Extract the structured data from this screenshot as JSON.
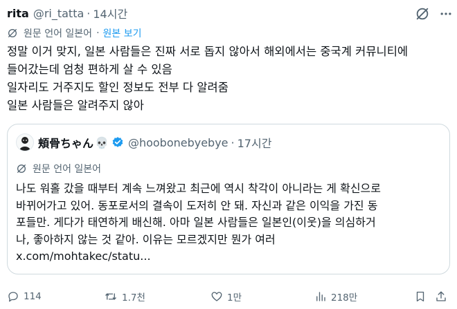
{
  "post": {
    "author_name": "rita",
    "author_handle": "@ri_tatta",
    "separator": "·",
    "time": "14시간",
    "translate_label": "원문 언어 일본어",
    "show_original_label": "원본 보기",
    "body_lines": [
      "정말 이거 맞지, 일본 사람들은 진짜 서로 돕지 않아서 해외에서는 중국계 커뮤니티에",
      "들어갔는데 엄청 편하게 살 수 있음",
      "일자리도 거주지도 할인 정보도 전부 다 알려줌",
      "일본 사람들은 알려주지 않아"
    ]
  },
  "quote": {
    "author_name": "頬骨ちゃん",
    "author_emoji": "💀",
    "author_handle": "@hoobonebyebye",
    "separator": "·",
    "time": "17시간",
    "translate_label": "원문 언어 일본어",
    "text_lines": [
      "나도 워홀 갔을 때부터 계속 느껴왔고 최근에 역시 착각이 아니라는 게 확신으로",
      "바뀌어가고 있어. 동포로서의 결속이 도저히 안 돼. 자신과 같은 이익을 가진 동",
      "포들만. 게다가 태연하게 배신해. 아마 일본 사람들은 일본인(이웃)을 의심하거",
      "나, 좋아하지 않는 것 같아. 이유는 모르겠지만 뭔가 여러",
      "x.com/mohtakec/statu..."
    ]
  },
  "actions": {
    "reply_count": "114",
    "repost_count": "1.7천",
    "like_count": "1만",
    "view_count": "218만"
  },
  "icons": {
    "grok": "grok-icon",
    "more": "more-icon",
    "translate": "translate-icon",
    "verified": "verified-badge-icon",
    "reply": "reply-icon",
    "repost": "repost-icon",
    "like": "like-icon",
    "views": "views-icon",
    "bookmark": "bookmark-icon",
    "share": "share-icon"
  },
  "colors": {
    "text_primary": "#0f1419",
    "text_secondary": "#536471",
    "link": "#1d9bf0",
    "verified": "#1d9bf0",
    "border": "#cfd9de"
  }
}
